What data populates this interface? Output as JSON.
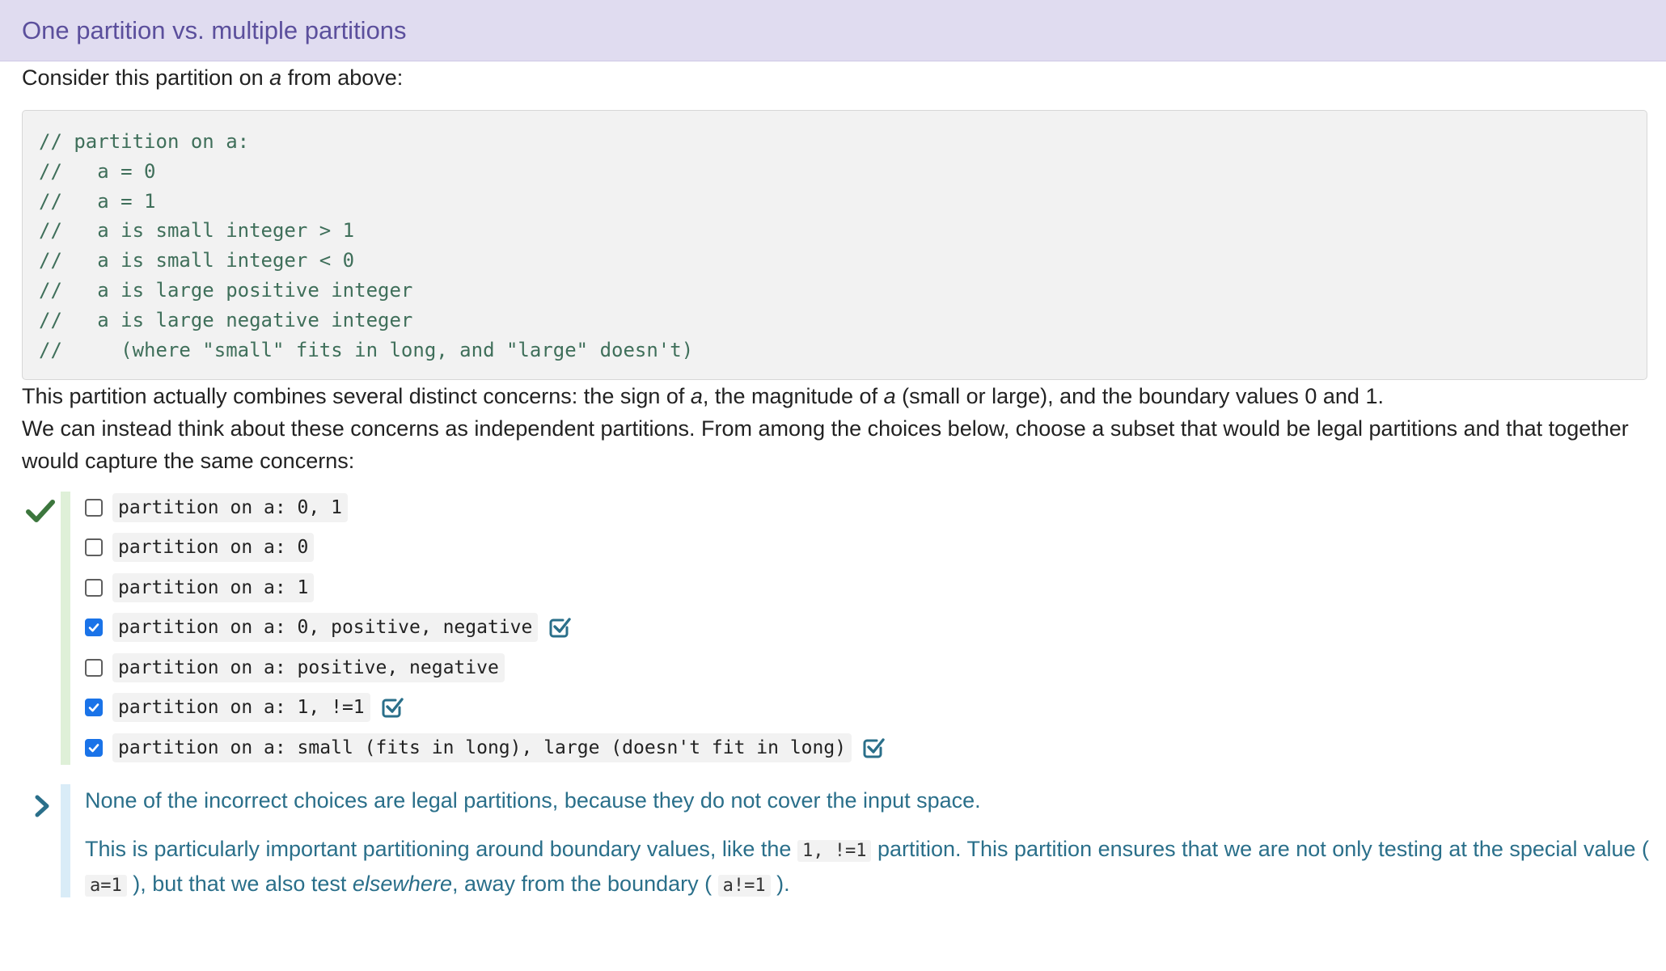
{
  "header": {
    "title": "One partition vs. multiple partitions"
  },
  "intro": {
    "before": "Consider this partition on ",
    "var": "a",
    "after": " from above:"
  },
  "code_lines": [
    "// partition on a:",
    "//   a = 0",
    "//   a = 1",
    "//   a is small integer > 1",
    "//   a is small integer < 0",
    "//   a is large positive integer",
    "//   a is large negative integer",
    "//     (where \"small\" fits in long, and \"large\" doesn't)"
  ],
  "para2": {
    "t1": "This partition actually combines several distinct concerns: the sign of ",
    "v1": "a",
    "t2": ", the magnitude of ",
    "v2": "a",
    "t3": " (small or large), and the boundary values 0 and 1."
  },
  "para3": "We can instead think about these concerns as independent partitions. From among the choices below, choose a subset that would be legal partitions and that together would capture the same concerns:",
  "choices": [
    {
      "label": "partition on a: 0, 1",
      "checked": false,
      "verified": false
    },
    {
      "label": "partition on a: 0",
      "checked": false,
      "verified": false
    },
    {
      "label": "partition on a: 1",
      "checked": false,
      "verified": false
    },
    {
      "label": "partition on a: 0, positive, negative",
      "checked": true,
      "verified": true
    },
    {
      "label": "partition on a: positive, negative",
      "checked": false,
      "verified": false
    },
    {
      "label": "partition on a: 1, !=1",
      "checked": true,
      "verified": true
    },
    {
      "label": "partition on a: small (fits in long), large (doesn't fit in long)",
      "checked": true,
      "verified": true
    }
  ],
  "explanation": {
    "p1": "None of the incorrect choices are legal partitions, because they do not cover the input space.",
    "p2_t1": "This is particularly important partitioning around boundary values, like the ",
    "p2_c1": "1, !=1",
    "p2_t2": " partition. This partition ensures that we are not only testing at the special value ( ",
    "p2_c2": "a=1",
    "p2_t3": " ), but that we also test ",
    "p2_em": "elsewhere",
    "p2_t4": ", away from the boundary ( ",
    "p2_c3": "a!=1",
    "p2_t5": " )."
  },
  "colors": {
    "header_bg": "#e0dcf0",
    "header_text": "#5b4f9c",
    "code_text": "#3f6f5a",
    "correct_green": "#3c763d",
    "checkbox_blue": "#1a73e8",
    "explanation_text": "#2a6f8a"
  },
  "icons": {
    "correct": "checkmark-icon",
    "verified": "check-square-icon",
    "expand": "chevron-right-icon"
  }
}
